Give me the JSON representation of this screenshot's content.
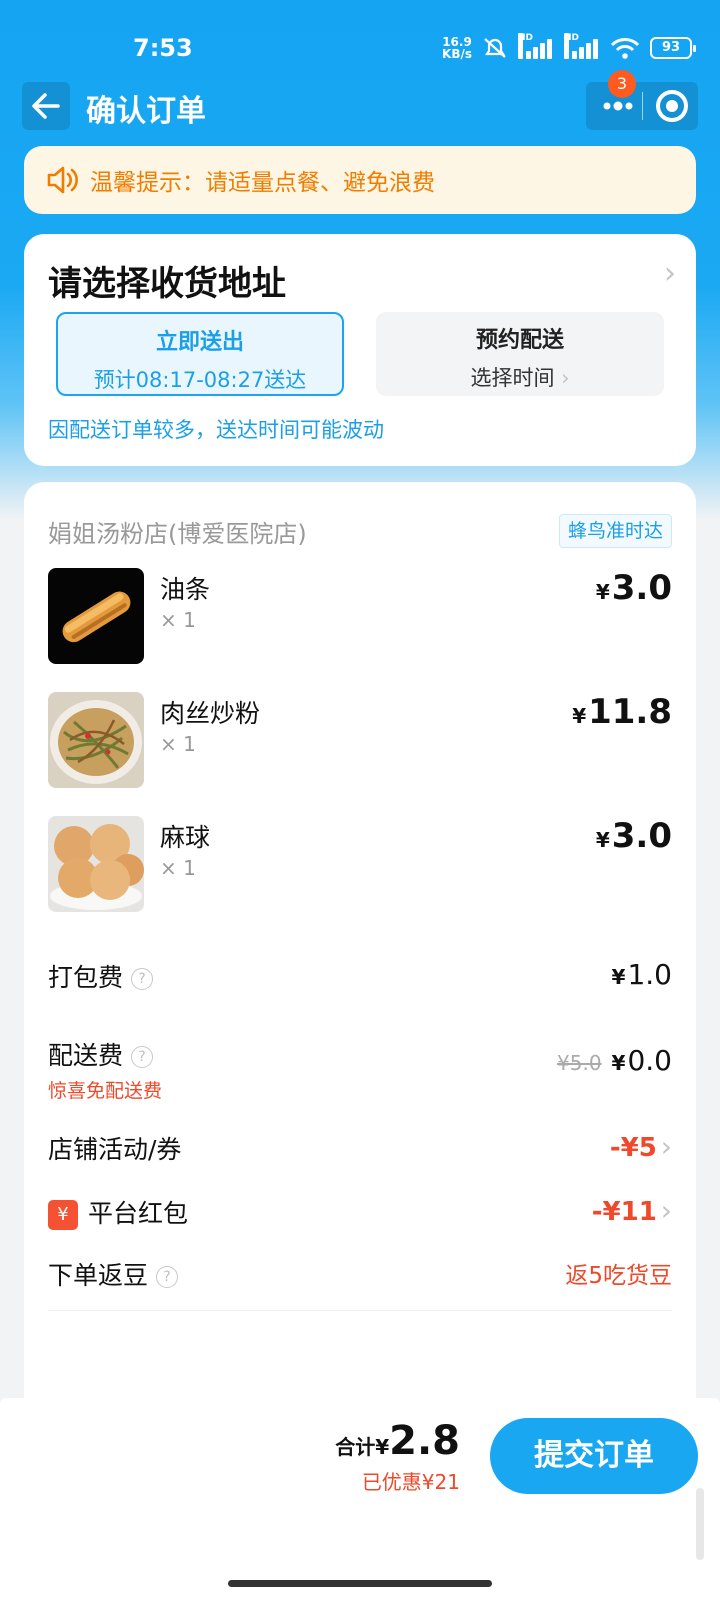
{
  "status_bar": {
    "time": "7:53",
    "net_speed_value": "16.9",
    "net_speed_unit": "KB/s",
    "hd1": "HD",
    "hd2": "HD",
    "battery": "93"
  },
  "nav": {
    "title": "确认订单",
    "badge_count": "3"
  },
  "tip": {
    "text": "温馨提示：请适量点餐、避免浪费"
  },
  "address": {
    "title": "请选择收货地址",
    "deliver_now_label": "立即送出",
    "deliver_now_eta": "预计08:17-08:27送达",
    "deliver_later_label": "预约配送",
    "deliver_later_action": "选择时间",
    "note": "因配送订单较多，送达时间可能波动"
  },
  "order": {
    "shop_name": "娟姐汤粉店(博爱医院店)",
    "delivery_badge": "蜂鸟准时达",
    "currency": "¥",
    "items": [
      {
        "name": "油条",
        "qty": "× 1",
        "price": "3.0"
      },
      {
        "name": "肉丝炒粉",
        "qty": "× 1",
        "price": "11.8"
      },
      {
        "name": "麻球",
        "qty": "× 1",
        "price": "3.0"
      }
    ],
    "packing_fee": {
      "label": "打包费",
      "value": "1.0"
    },
    "delivery_fee": {
      "label": "配送费",
      "original": "¥5.0",
      "value": "0.0",
      "promo": "惊喜免配送费"
    },
    "store_coupon": {
      "label": "店铺活动/券",
      "value": "-¥5"
    },
    "red_packet": {
      "icon_text": "¥",
      "label": "平台红包",
      "value": "-¥11"
    },
    "beans": {
      "label": "下单返豆",
      "value": "返5吃货豆"
    }
  },
  "bottom": {
    "total_label": "合计¥",
    "total_amount": "2.8",
    "saved": "已优惠¥21",
    "submit_label": "提交订单"
  },
  "colors": {
    "brand_blue": "#18a7f0",
    "accent_red": "#f0482a",
    "tip_orange": "#f07d00"
  }
}
